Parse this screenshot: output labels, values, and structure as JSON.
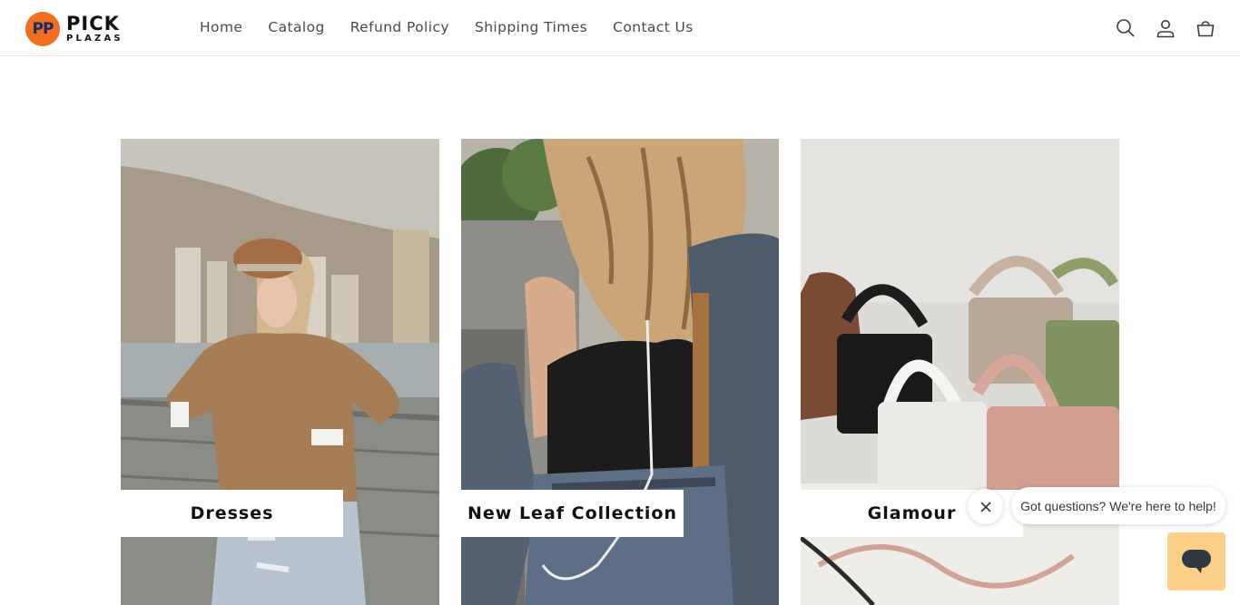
{
  "header": {
    "logo": {
      "badge": "PP",
      "line1": "PICK",
      "line2": "PLAZAS"
    },
    "nav": [
      {
        "label": "Home"
      },
      {
        "label": "Catalog"
      },
      {
        "label": "Refund Policy"
      },
      {
        "label": "Shipping Times"
      },
      {
        "label": "Contact Us"
      }
    ],
    "icons": [
      "search-icon",
      "account-icon",
      "cart-icon"
    ]
  },
  "collections": [
    {
      "label": "Dresses"
    },
    {
      "label": "New Leaf Collection"
    },
    {
      "label": "Glamour"
    }
  ],
  "chat": {
    "message": "Got questions? We're here to help!",
    "launcher_color": "#fdd08a"
  },
  "colors": {
    "brand_orange": "#f26f21",
    "brand_navy": "#1b2a6b"
  }
}
